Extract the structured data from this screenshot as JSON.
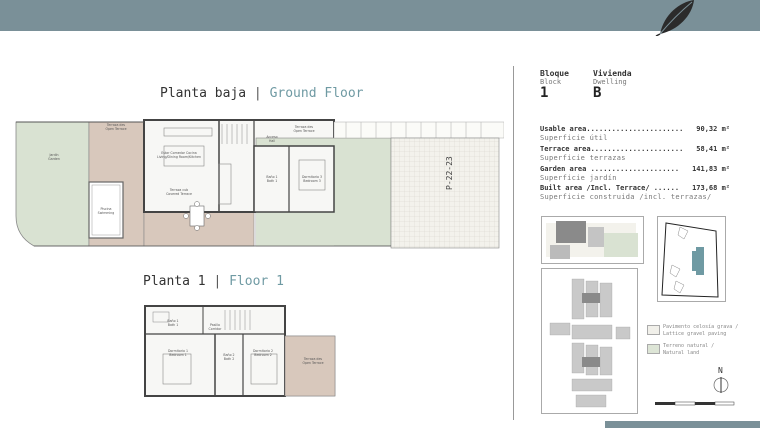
{
  "ground_floor": {
    "es": "Planta baja",
    "sep": "|",
    "en": "Ground Floor"
  },
  "first_floor": {
    "es": "Planta 1",
    "sep": "|",
    "en": "Floor 1"
  },
  "block": {
    "es": "Bloque",
    "en": "Block",
    "value": "1"
  },
  "dwelling": {
    "es": "Vivienda",
    "en": "Dwelling",
    "value": "B"
  },
  "areas": [
    {
      "label": "Usable area.......................",
      "value": "90,32 m²",
      "sub": "Superficie útil"
    },
    {
      "label": "Terrace area......................",
      "value": "58,41 m²",
      "sub": "Superficie terrazas"
    },
    {
      "label": "Garden area .....................",
      "value": "141,83 m²",
      "sub": "Superficie jardín"
    },
    {
      "label": "Built area /Incl. Terrace/ ......",
      "value": "173,68 m²",
      "sub": "Superficie construida /incl. terrazas/"
    }
  ],
  "legend": [
    {
      "es": "Pavimento celosía grava /",
      "en": "Lattice gravel paving",
      "color": "#f1f0ea"
    },
    {
      "es": "Terreno natural /",
      "en": "Natural land",
      "color": "#dde5d6"
    }
  ],
  "north": "N",
  "parking": "P-22-23",
  "rooms_gf": {
    "garden": "Jardín\nGarden",
    "terrace_garden": "Terraza des\nOpen Terrace",
    "pool": "Piscina\nSwimming",
    "living": "Estar Comedor Cocina\nLiving/Dining Room/Kitchen",
    "terrace_cov": "Terraza cub\nCovered Terrace",
    "access": "Acceso\nHall",
    "terrace_east": "Terraza des\nOpen Terrace",
    "bath1": "Baño 1\nBath 1",
    "bed3": "Dormitorio 3\nBedroom 3"
  },
  "rooms_f1": {
    "bath1": "Baño 1\nBath 1",
    "landing": "Pasillo\nCorridor",
    "bed1": "Dormitorio 1\nBedroom 1",
    "bath2": "Baño 2\nBath 2",
    "bed2": "Dormitorio 2\nBedroom 2",
    "terrace": "Terraza des\nOpen Terrace"
  },
  "colors": {
    "bar": "#7a9098",
    "garden": "#d9e2d2",
    "terrace": "#d8c8bc",
    "paving": "#f1f0ea",
    "accent": "#6f9aa3"
  }
}
